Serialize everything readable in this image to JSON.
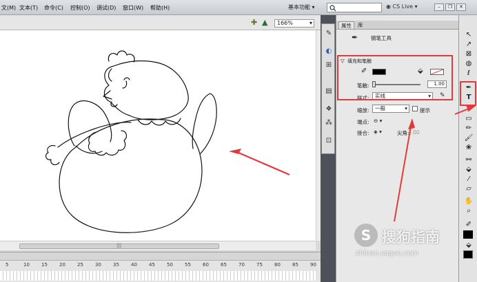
{
  "menu": {
    "items": [
      "文(M)",
      "文本(T)",
      "命令(C)",
      "控制(O)",
      "调试(D)",
      "窗口(W)",
      "帮助(H)"
    ],
    "workspace": "基本功能",
    "cslive": "CS Live"
  },
  "stage": {
    "zoom": "166%",
    "scroll_grip": "|||"
  },
  "timeline": {
    "ticks": [
      "5",
      "10",
      "15",
      "20",
      "25",
      "30",
      "35",
      "40",
      "45",
      "50",
      "55",
      "60",
      "65",
      "70",
      "75",
      "80",
      "85",
      "90"
    ]
  },
  "panel": {
    "tab_properties": "属性",
    "tab_library": "库",
    "tool_name": "钢笔工具",
    "section_fill_stroke": "填充和笔触",
    "stroke_label": "笔触:",
    "stroke_value": "1.00",
    "style_label": "样式:",
    "style_value": "实线",
    "scale_label": "缩放:",
    "scale_value": "一般",
    "hint_label": "提示",
    "cap_label": "端点:",
    "join_label": "接合:",
    "miter_label": "尖角:",
    "miter_value": "3.00"
  },
  "watermark": {
    "brand": "搜狗指南",
    "url": "zhinan.sogou.com"
  },
  "colors": {
    "annotation": "#e23a3a",
    "stroke_color": "#000000"
  }
}
